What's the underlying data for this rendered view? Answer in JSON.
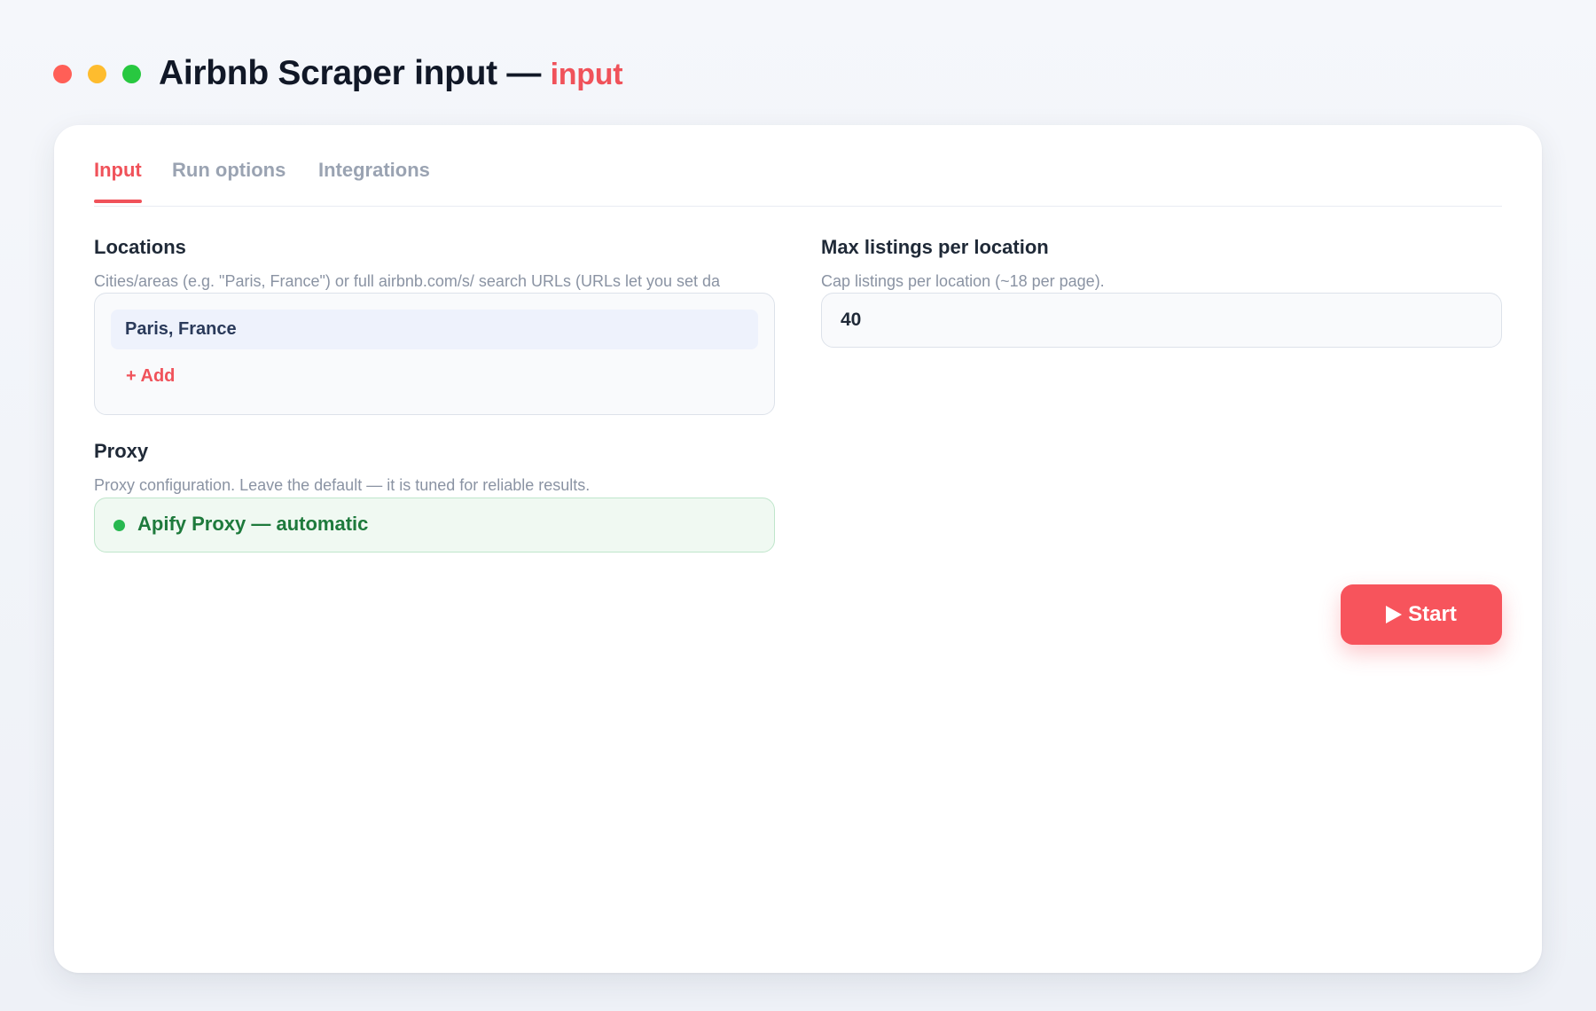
{
  "window": {
    "title": "Airbnb Scraper input —",
    "title_accent": "input",
    "controls": [
      "close",
      "minimize",
      "zoom"
    ]
  },
  "tabs": [
    {
      "label": "Input",
      "active": true
    },
    {
      "label": "Run options",
      "active": false
    },
    {
      "label": "Integrations",
      "active": false
    }
  ],
  "fields": {
    "locations": {
      "label": "Locations",
      "help": "Cities/areas (e.g. \"Paris, France\") or full airbnb.com/s/ search URLs (URLs let you set da",
      "items": [
        "Paris, France"
      ],
      "add_label": "+ Add"
    },
    "max_listings": {
      "label": "Max listings per location",
      "help": "Cap listings per location (~18 per page).",
      "value": "40"
    },
    "proxy": {
      "label": "Proxy",
      "help": "Proxy configuration. Leave the default — it is tuned for reliable results.",
      "value": "Apify Proxy — automatic",
      "status_color": "#28b850"
    }
  },
  "actions": {
    "start_label": "Start",
    "start_icon": "play-icon"
  },
  "colors": {
    "accent": "#f0525a",
    "button": "#f7545c",
    "success_text": "#1e7a3c"
  }
}
